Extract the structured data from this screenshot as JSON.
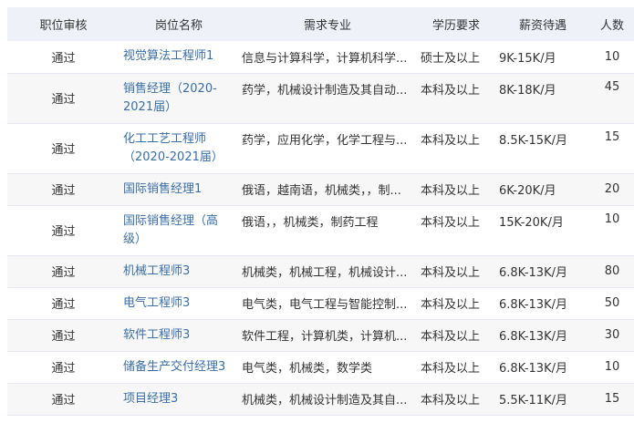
{
  "table": {
    "headers": [
      "职位审核",
      "岗位名称",
      "需求专业",
      "学历要求",
      "薪资待遇",
      "人数"
    ],
    "rows": [
      {
        "status": "通过",
        "name": "视觉算法工程师1",
        "major": "信息与计算科学，计算机科学...",
        "education": "硕士及以上",
        "salary": "9K-15K/月",
        "count": "10"
      },
      {
        "status": "通过",
        "name": "销售经理（2020-2021届）",
        "major": "药学，机械设计制造及其自动...",
        "education": "本科及以上",
        "salary": "8K-18K/月",
        "count": "45"
      },
      {
        "status": "通过",
        "name": "化工工艺工程师（2020-2021届）",
        "major": "药学，应用化学，化学工程与...",
        "education": "本科及以上",
        "salary": "8.5K-15K/月",
        "count": "15"
      },
      {
        "status": "通过",
        "name": "国际销售经理1",
        "major": "俄语，越南语，机械类，，制...",
        "education": "本科及以上",
        "salary": "6K-20K/月",
        "count": "20"
      },
      {
        "status": "通过",
        "name": "国际销售经理（高级）",
        "major": "俄语，，机械类，制药工程",
        "education": "本科及以上",
        "salary": "15K-20K/月",
        "count": "10"
      },
      {
        "status": "通过",
        "name": "机械工程师3",
        "major": "机械类，机械工程，机械设计...",
        "education": "本科及以上",
        "salary": "6.8K-13K/月",
        "count": "80"
      },
      {
        "status": "通过",
        "name": "电气工程师3",
        "major": "电气类，电气工程与智能控制...",
        "education": "本科及以上",
        "salary": "6.8K-13K/月",
        "count": "50"
      },
      {
        "status": "通过",
        "name": "软件工程师3",
        "major": "软件工程，计算机类，计算机...",
        "education": "本科及以上",
        "salary": "6.8K-13K/月",
        "count": "30"
      },
      {
        "status": "通过",
        "name": "储备生产交付经理3",
        "major": "电气类，机械类，数学类",
        "education": "本科及以上",
        "salary": "6.8K-13K/月",
        "count": "10"
      },
      {
        "status": "通过",
        "name": "项目经理3",
        "major": "机械类，机械设计制造及其自...",
        "education": "本科及以上",
        "salary": "5.5K-11K/月",
        "count": "15"
      }
    ]
  }
}
